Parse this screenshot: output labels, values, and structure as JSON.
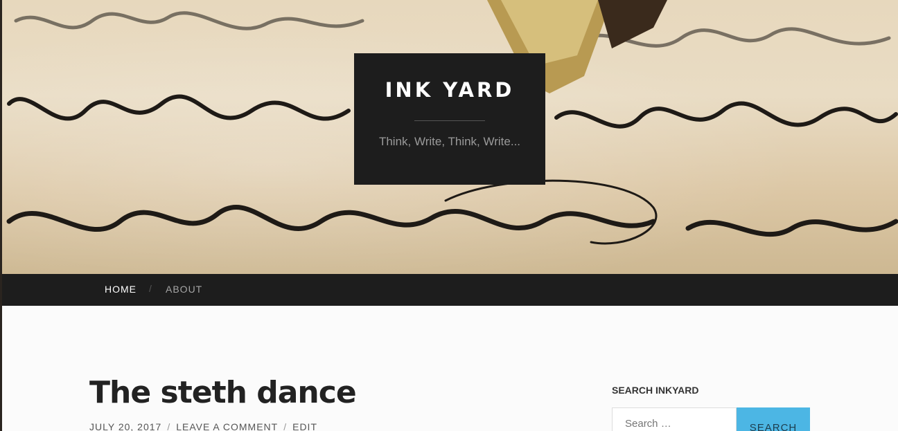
{
  "site": {
    "title": "INK YARD",
    "tagline": "Think, Write, Think, Write..."
  },
  "nav": {
    "items": [
      {
        "label": "HOME",
        "active": true
      },
      {
        "label": "ABOUT",
        "active": false
      }
    ],
    "separator": "/"
  },
  "post": {
    "title": "The steth dance",
    "meta": {
      "date": "JULY 20, 2017",
      "comment_link": "LEAVE A COMMENT",
      "edit_link": "EDIT",
      "separator": "/"
    }
  },
  "sidebar": {
    "search_widget": {
      "title": "SEARCH INKYARD",
      "placeholder": "Search …",
      "button_label": "SEARCH"
    }
  },
  "colors": {
    "header_box": "#1d1d1d",
    "nav_bar": "#1d1d1d",
    "search_button": "#4cb6e4",
    "content_bg": "#fbfbfb"
  },
  "icons": {
    "header_image": "fountain-pen-on-handwritten-letter"
  }
}
